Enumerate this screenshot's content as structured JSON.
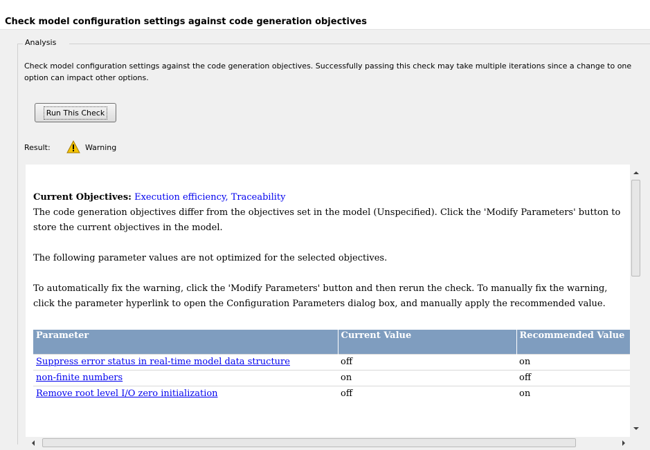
{
  "header": {
    "title": "Check model configuration settings against code generation objectives"
  },
  "analysis": {
    "legend": "Analysis",
    "description": "Check model configuration settings against the code generation objectives. Successfully passing this check may take multiple iterations since a change to one option can impact other options.",
    "run_button": "Run This Check",
    "result_label": "Result:",
    "result_value": "Warning",
    "result_icon": "warning-icon"
  },
  "report": {
    "objectives_label": "Current Objectives:",
    "objectives_value": "Execution efficiency, Traceability",
    "para1": "The code generation objectives differ from the objectives set in the model (Unspecified). Click the 'Modify Parameters' button to store the current objectives in the model.",
    "para2": "The following parameter values are not optimized for the selected objectives.",
    "para3": "To automatically fix the warning, click the 'Modify Parameters' button and then rerun the check. To manually fix the warning, click the parameter hyperlink to open the Configuration Parameters dialog box, and manually apply the recommended value.",
    "table": {
      "headers": [
        "Parameter",
        "Current Value",
        "Recommended Value"
      ],
      "rows": [
        {
          "parameter": "Suppress error status in real-time model data structure",
          "current": "off",
          "recommended": "on"
        },
        {
          "parameter": "non-finite numbers",
          "current": "on",
          "recommended": "off"
        },
        {
          "parameter": "Remove root level I/O zero initialization",
          "current": "off",
          "recommended": "on"
        }
      ]
    }
  },
  "colors": {
    "table_header": "#7f9dbf",
    "link": "#0000ee",
    "warning": "#f5c400"
  }
}
